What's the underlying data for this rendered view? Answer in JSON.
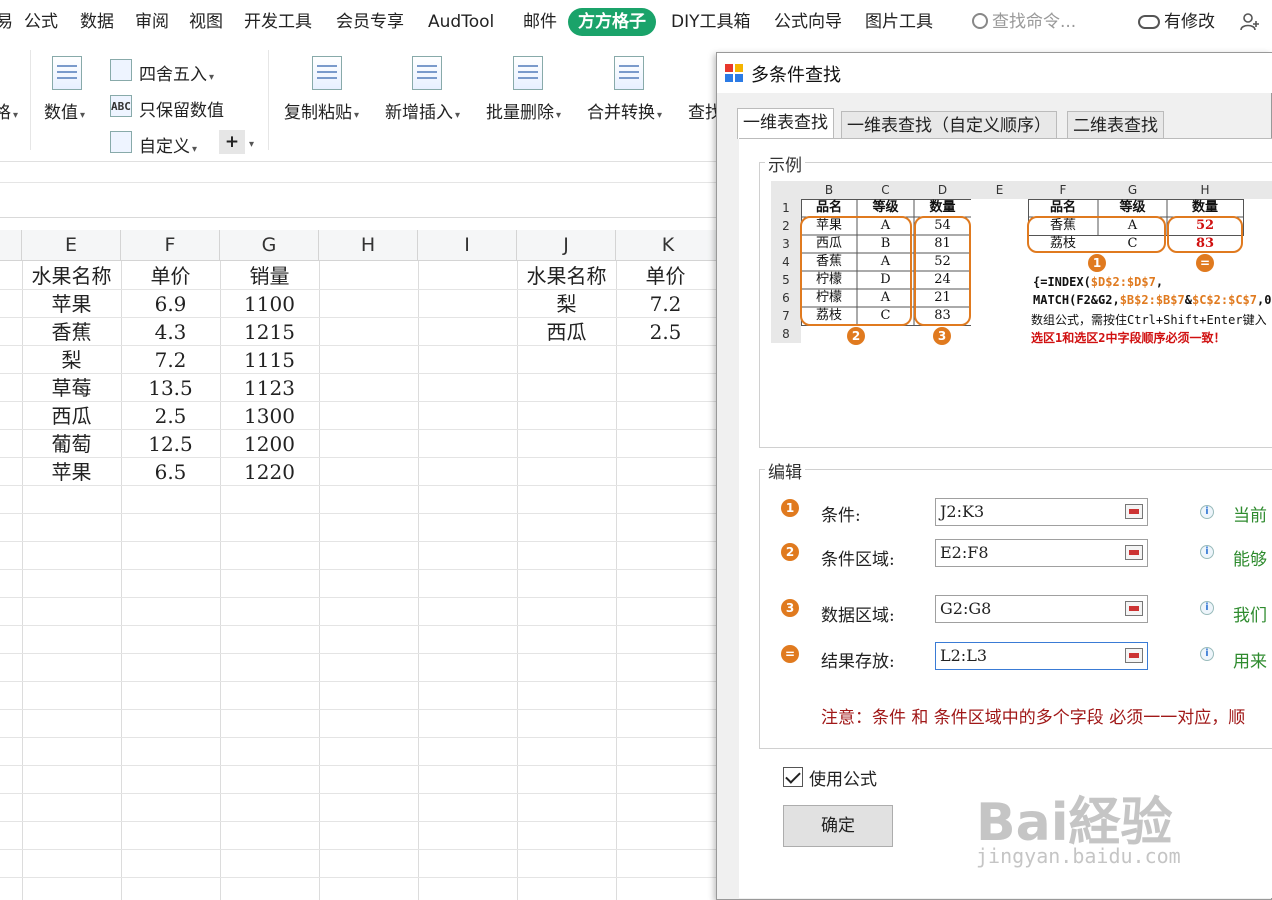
{
  "menu": {
    "items": [
      "易",
      "公式",
      "数据",
      "审阅",
      "视图",
      "开发工具",
      "会员专享",
      "AudTool",
      "邮件",
      "方方格子",
      "DIY工具箱",
      "公式向导",
      "图片工具"
    ],
    "active_index": 9,
    "search_placeholder": "查找命令...",
    "modified_label": "有修改"
  },
  "ribbon": {
    "left_partial": "格",
    "value_label": "数值",
    "round_label": "四舍五入",
    "keep_values_label": "只保留数值",
    "custom_label": "自定义",
    "plus_label": "+",
    "copy_paste_label": "复制粘贴",
    "insert_label": "新增插入",
    "batch_delete_label": "批量删除",
    "merge_convert_label": "合并转换",
    "find_partial": "查找"
  },
  "sheet": {
    "columns": [
      "E",
      "F",
      "G",
      "H",
      "I",
      "J",
      "K"
    ],
    "table1": {
      "headers": [
        "水果名称",
        "单价",
        "销量"
      ],
      "rows": [
        [
          "苹果",
          "6.9",
          "1100"
        ],
        [
          "香蕉",
          "4.3",
          "1215"
        ],
        [
          "梨",
          "7.2",
          "1115"
        ],
        [
          "草莓",
          "13.5",
          "1123"
        ],
        [
          "西瓜",
          "2.5",
          "1300"
        ],
        [
          "葡萄",
          "12.5",
          "1200"
        ],
        [
          "苹果",
          "6.5",
          "1220"
        ]
      ]
    },
    "table2": {
      "headers": [
        "水果名称",
        "单价"
      ],
      "rows": [
        [
          "梨",
          "7.2"
        ],
        [
          "西瓜",
          "2.5"
        ]
      ]
    }
  },
  "dialog": {
    "title": "多条件查找",
    "tabs": [
      "一维表查找",
      "一维表查找（自定义顺序）",
      "二维表查找"
    ],
    "example_group_title": "示例",
    "example": {
      "col_letters": [
        "B",
        "C",
        "D",
        "E",
        "F",
        "G",
        "H"
      ],
      "row_numbers": [
        "1",
        "2",
        "3",
        "4",
        "5",
        "6",
        "7",
        "8"
      ],
      "left_headers": [
        "品名",
        "等级",
        "数量"
      ],
      "left_rows": [
        [
          "苹果",
          "A",
          "54"
        ],
        [
          "西瓜",
          "B",
          "81"
        ],
        [
          "香蕉",
          "A",
          "52"
        ],
        [
          "柠檬",
          "D",
          "24"
        ],
        [
          "柠檬",
          "A",
          "21"
        ],
        [
          "荔枝",
          "C",
          "83"
        ]
      ],
      "right_headers": [
        "品名",
        "等级",
        "数量"
      ],
      "right_rows": [
        [
          "香蕉",
          "A",
          "52"
        ],
        [
          "荔枝",
          "C",
          "83"
        ]
      ],
      "badges": [
        "1",
        "2",
        "3",
        "="
      ],
      "formula_line1_prefix": "{=INDEX(",
      "formula_line1_range": "$D$2:$D$7",
      "formula_line1_suffix": ",",
      "formula_line2_prefix": "MATCH(F2&G2,",
      "formula_line2_range1": "$B$2:$B$7",
      "formula_line2_amp": "&",
      "formula_line2_range2": "$C$2:$C$7",
      "formula_line2_suffix": ",0",
      "formula_note": "数组公式，需按住Ctrl+Shift+Enter键入",
      "warning": "选区1和选区2中字段顺序必须一致！"
    },
    "edit_group_title": "编辑",
    "fields": [
      {
        "badge": "1",
        "label": "条件:",
        "value": "J2:K3",
        "hint": "当前"
      },
      {
        "badge": "2",
        "label": "条件区域:",
        "value": "E2:F8",
        "hint": "能够"
      },
      {
        "badge": "3",
        "label": "数据区域:",
        "value": "G2:G8",
        "hint": "我们"
      },
      {
        "badge": "=",
        "label": "结果存放:",
        "value": "L2:L3",
        "hint": "用来"
      }
    ],
    "note": "注意：条件 和 条件区域中的多个字段 必须一一对应，顺",
    "use_formula_label": "使用公式",
    "use_formula_checked": true,
    "ok_label": "确定"
  },
  "watermark": {
    "main": "Bai経验",
    "sub": "jingyan.baidu.com"
  },
  "colors": {
    "accent_green": "#1aa36a",
    "orange": "#e07a1f",
    "warning_red": "#d01010",
    "hint_green": "#2e8b2e",
    "note_red": "#a01818"
  }
}
